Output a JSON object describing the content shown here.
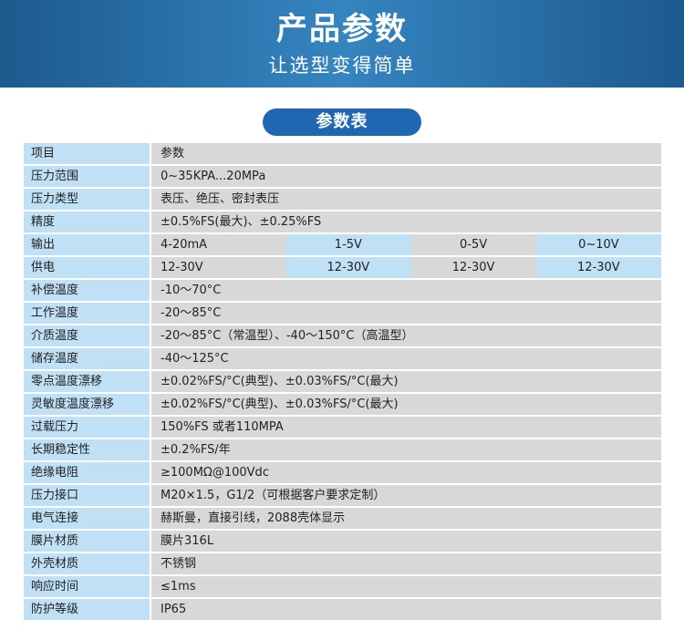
{
  "header": {
    "title": "产品参数",
    "subtitle": "让选型变得简单"
  },
  "section": {
    "title": "参数表"
  },
  "rows": [
    {
      "label": "项目",
      "value": "参数"
    },
    {
      "label": "压力范围",
      "value": "0~35KPA...20MPa"
    },
    {
      "label": "压力类型",
      "value": "表压、绝压、密封表压"
    },
    {
      "label": "精度",
      "value": "±0.5%FS(最大)、±0.25%FS"
    },
    {
      "label": "输出",
      "cells": [
        "4-20mA",
        "1-5V",
        "0-5V",
        "0~10V"
      ]
    },
    {
      "label": "供电",
      "cells": [
        "12-30V",
        "12-30V",
        "12-30V",
        "12-30V"
      ]
    },
    {
      "label": "补偿温度",
      "value": "-10～70°C"
    },
    {
      "label": "工作温度",
      "value": "-20～85°C"
    },
    {
      "label": "介质温度",
      "value": "-20～85°C（常温型）、-40～150°C（高温型）"
    },
    {
      "label": "储存温度",
      "value": "-40～125°C"
    },
    {
      "label": "零点温度漂移",
      "value": "±0.02%FS/°C(典型)、±0.03%FS/°C(最大)"
    },
    {
      "label": "灵敏度温度漂移",
      "value": "±0.02%FS/°C(典型)、±0.03%FS/°C(最大)"
    },
    {
      "label": "过载压力",
      "value": "150%FS 或者110MPA"
    },
    {
      "label": "长期稳定性",
      "value": "±0.2%FS/年"
    },
    {
      "label": "绝缘电阻",
      "value": "≥100MΩ@100Vdc"
    },
    {
      "label": "压力接口",
      "value": "M20×1.5，G1/2（可根据客户要求定制）"
    },
    {
      "label": "电气连接",
      "value": "赫斯曼，直接引线，2088壳体显示"
    },
    {
      "label": "膜片材质",
      "value": "膜片316L"
    },
    {
      "label": "外壳材质",
      "value": "不锈钢"
    },
    {
      "label": "响应时间",
      "value": "≤1ms"
    },
    {
      "label": "防护等级",
      "value": "IP65"
    }
  ]
}
